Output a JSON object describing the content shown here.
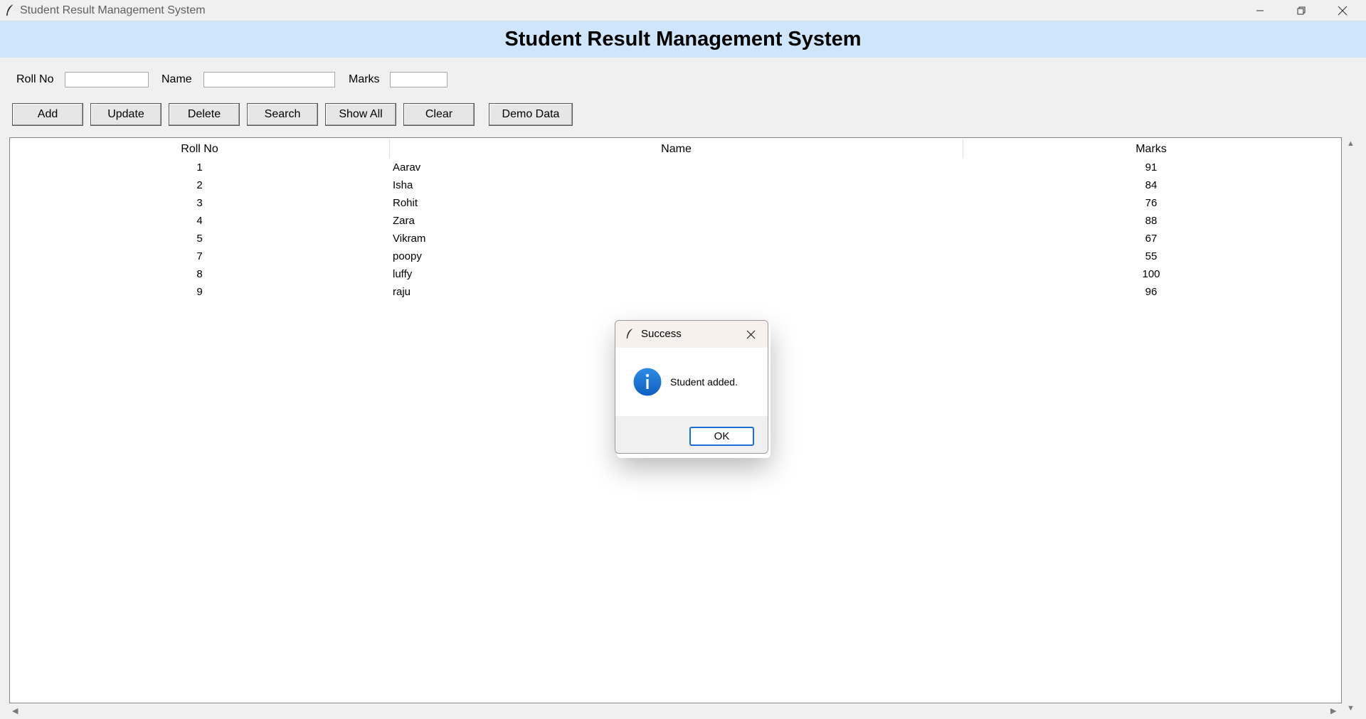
{
  "window": {
    "title": "Student Result Management System",
    "controls": [
      "minimize-icon",
      "restore-icon",
      "close-icon"
    ]
  },
  "header": {
    "title": "Student Result Management System",
    "bg_color": "#cfe6fa"
  },
  "form": {
    "roll_label": "Roll No",
    "name_label": "Name",
    "marks_label": "Marks",
    "roll_value": "",
    "name_value": "",
    "marks_value": ""
  },
  "buttons": {
    "add": "Add",
    "update": "Update",
    "delete": "Delete",
    "search": "Search",
    "show_all": "Show All",
    "clear": "Clear",
    "demo_data": "Demo Data"
  },
  "table": {
    "columns": [
      "Roll No",
      "Name",
      "Marks"
    ],
    "rows": [
      {
        "roll": "1",
        "name": "Aarav",
        "marks": "91"
      },
      {
        "roll": "2",
        "name": "Isha",
        "marks": "84"
      },
      {
        "roll": "3",
        "name": "Rohit",
        "marks": "76"
      },
      {
        "roll": "4",
        "name": "Zara",
        "marks": "88"
      },
      {
        "roll": "5",
        "name": "Vikram",
        "marks": "67"
      },
      {
        "roll": "7",
        "name": "poopy",
        "marks": "55"
      },
      {
        "roll": "8",
        "name": "luffy",
        "marks": "100"
      },
      {
        "roll": "9",
        "name": "raju",
        "marks": "96"
      }
    ]
  },
  "dialog": {
    "title": "Success",
    "message": "Student added.",
    "ok_label": "OK",
    "icon": "info-icon",
    "accent_color": "#1a6fd6"
  }
}
